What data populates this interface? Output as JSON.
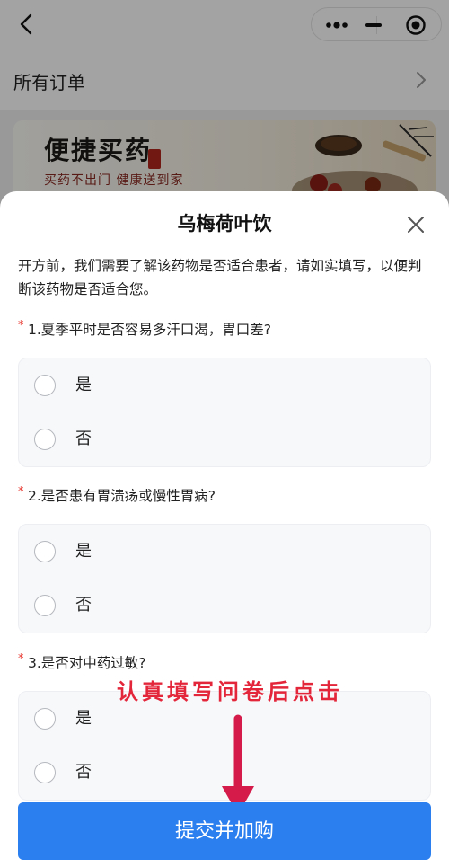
{
  "nav": {
    "orders_label": "所有订单"
  },
  "banner": {
    "title": "便捷买药",
    "subtitle": "买药不出门 健康送到家"
  },
  "sheet": {
    "title": "乌梅荷叶饮",
    "intro": "开方前，我们需要了解该药物是否适合患者，请如实填写，以便判断该药物是否适合您。",
    "required_mark": "*",
    "questions": [
      {
        "text": "1.夏季平时是否容易多汗口渴，胃口差?",
        "options": [
          "是",
          "否"
        ]
      },
      {
        "text": "2.是否患有胃溃疡或慢性胃病?",
        "options": [
          "是",
          "否"
        ]
      },
      {
        "text": "3.是否对中药过敏?",
        "options": [
          "是",
          "否"
        ]
      }
    ]
  },
  "annotation": {
    "text": "认真填写问卷后点击",
    "color": "#e4263b"
  },
  "submit": {
    "label": "提交并加购",
    "color": "#2b7fef"
  },
  "icons": [
    "back-arrow-icon",
    "more-dots-icon",
    "minimize-icon",
    "target-circle-icon",
    "chevron-right-icon",
    "close-icon",
    "down-arrow-icon"
  ]
}
